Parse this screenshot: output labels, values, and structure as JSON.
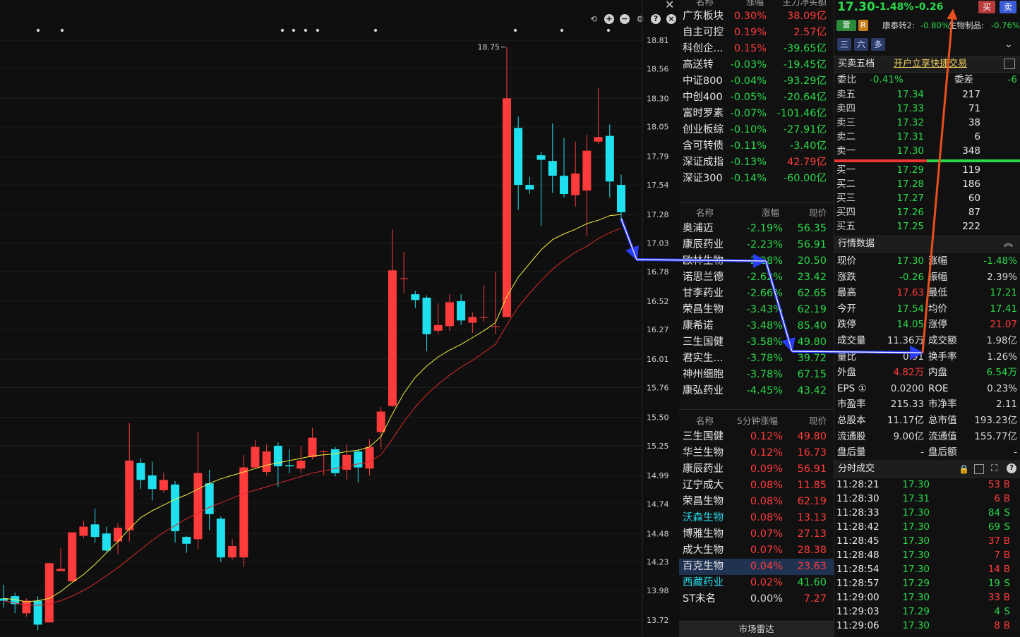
{
  "chart": {
    "price_ticks": [
      "18.81",
      "18.56",
      "18.30",
      "18.05",
      "17.79",
      "17.54",
      "17.28",
      "17.03",
      "16.78",
      "16.52",
      "16.27",
      "16.01",
      "15.76",
      "15.50",
      "15.25",
      "14.99",
      "14.74",
      "14.48",
      "14.23",
      "13.98",
      "13.72"
    ],
    "high_label": "18.75",
    "candles": [
      {
        "o": 13.91,
        "c": 13.89,
        "h": 14.03,
        "l": 13.83
      },
      {
        "o": 13.93,
        "c": 13.86,
        "h": 13.96,
        "l": 13.78
      },
      {
        "o": 13.78,
        "c": 13.89,
        "h": 13.91,
        "l": 13.75
      },
      {
        "o": 13.89,
        "c": 13.68,
        "h": 13.93,
        "l": 13.63
      },
      {
        "o": 13.7,
        "c": 14.22,
        "h": 14.22,
        "l": 13.7
      },
      {
        "o": 14.15,
        "c": 14.17,
        "h": 14.35,
        "l": 14.15
      },
      {
        "o": 14.06,
        "c": 14.49,
        "h": 14.49,
        "l": 14.06
      },
      {
        "o": 14.46,
        "c": 14.54,
        "h": 14.59,
        "l": 14.44
      },
      {
        "o": 14.56,
        "c": 14.45,
        "h": 14.7,
        "l": 14.4
      },
      {
        "o": 14.48,
        "c": 14.33,
        "h": 14.54,
        "l": 14.31
      },
      {
        "o": 14.41,
        "c": 14.53,
        "h": 14.57,
        "l": 14.3
      },
      {
        "o": 14.51,
        "c": 15.12,
        "h": 15.45,
        "l": 14.41
      },
      {
        "o": 15.1,
        "c": 14.95,
        "h": 15.14,
        "l": 14.87
      },
      {
        "o": 14.99,
        "c": 14.87,
        "h": 15.11,
        "l": 14.77
      },
      {
        "o": 14.86,
        "c": 14.95,
        "h": 15.01,
        "l": 14.84
      },
      {
        "o": 14.91,
        "c": 14.5,
        "h": 14.94,
        "l": 14.4
      },
      {
        "o": 14.45,
        "c": 14.39,
        "h": 14.46,
        "l": 14.31
      },
      {
        "o": 14.43,
        "c": 15.01,
        "h": 15.37,
        "l": 14.34
      },
      {
        "o": 14.92,
        "c": 14.65,
        "h": 15.04,
        "l": 14.51
      },
      {
        "o": 14.61,
        "c": 14.27,
        "h": 14.63,
        "l": 14.23
      },
      {
        "o": 14.27,
        "c": 14.37,
        "h": 14.43,
        "l": 14.25
      },
      {
        "o": 14.27,
        "c": 15.06,
        "h": 15.17,
        "l": 14.19
      },
      {
        "o": 15.06,
        "c": 15.24,
        "h": 15.3,
        "l": 15.05
      },
      {
        "o": 15.02,
        "c": 15.2,
        "h": 15.26,
        "l": 14.99
      },
      {
        "o": 15.25,
        "c": 15.07,
        "h": 15.28,
        "l": 14.89
      },
      {
        "o": 15.08,
        "c": 15.07,
        "h": 15.22,
        "l": 15.01
      },
      {
        "o": 15.05,
        "c": 15.12,
        "h": 15.25,
        "l": 15.01
      },
      {
        "o": 15.15,
        "c": 15.32,
        "h": 15.41,
        "l": 15.13
      },
      {
        "o": 15.2,
        "c": 15.2,
        "h": 15.21,
        "l": 14.99
      },
      {
        "o": 15.22,
        "c": 15.01,
        "h": 15.24,
        "l": 14.98
      },
      {
        "o": 15.04,
        "c": 15.17,
        "h": 15.26,
        "l": 14.95
      },
      {
        "o": 15.2,
        "c": 15.06,
        "h": 15.22,
        "l": 14.93
      },
      {
        "o": 15.05,
        "c": 15.24,
        "h": 15.31,
        "l": 14.99
      },
      {
        "o": 15.37,
        "c": 15.55,
        "h": 15.59,
        "l": 15.22
      },
      {
        "o": 15.6,
        "c": 16.79,
        "h": 17.15,
        "l": 15.59
      },
      {
        "o": 16.72,
        "c": 16.72,
        "h": 16.95,
        "l": 16.59
      },
      {
        "o": 16.58,
        "c": 16.53,
        "h": 16.61,
        "l": 16.46
      },
      {
        "o": 16.55,
        "c": 16.23,
        "h": 16.57,
        "l": 16.08
      },
      {
        "o": 16.26,
        "c": 16.31,
        "h": 16.5,
        "l": 16.23
      },
      {
        "o": 16.3,
        "c": 16.51,
        "h": 16.58,
        "l": 16.26
      },
      {
        "o": 16.52,
        "c": 16.35,
        "h": 16.58,
        "l": 16.31
      },
      {
        "o": 16.33,
        "c": 16.38,
        "h": 16.42,
        "l": 16.24
      },
      {
        "o": 16.38,
        "c": 16.38,
        "h": 16.66,
        "l": 16.34
      },
      {
        "o": 16.3,
        "c": 16.3,
        "h": 16.78,
        "l": 16.23
      },
      {
        "o": 16.38,
        "c": 18.3,
        "h": 18.75,
        "l": 16.38
      },
      {
        "o": 18.04,
        "c": 17.54,
        "h": 18.14,
        "l": 17.32
      },
      {
        "o": 17.54,
        "c": 17.5,
        "h": 17.61,
        "l": 17.46
      },
      {
        "o": 17.8,
        "c": 17.76,
        "h": 17.83,
        "l": 17.18
      },
      {
        "o": 17.75,
        "c": 17.62,
        "h": 18.08,
        "l": 17.47
      },
      {
        "o": 17.62,
        "c": 17.46,
        "h": 17.95,
        "l": 17.43
      },
      {
        "o": 17.45,
        "c": 17.64,
        "h": 17.92,
        "l": 17.35
      },
      {
        "o": 17.49,
        "c": 17.84,
        "h": 17.98,
        "l": 17.09
      },
      {
        "o": 17.92,
        "c": 17.96,
        "h": 18.39,
        "l": 17.9
      },
      {
        "o": 17.97,
        "c": 17.57,
        "h": 18.07,
        "l": 17.43
      },
      {
        "o": 17.54,
        "c": 17.3,
        "h": 17.63,
        "l": 17.21
      }
    ],
    "ma_yellow": [
      13.91,
      13.9,
      13.88,
      13.89,
      13.91,
      13.97,
      14.05,
      14.12,
      14.21,
      14.31,
      14.41,
      14.52,
      14.62,
      14.68,
      14.73,
      14.78,
      14.82,
      14.87,
      14.92,
      14.96,
      14.99,
      15.02,
      15.05,
      15.08,
      15.1,
      15.12,
      15.14,
      15.16,
      15.17,
      15.18,
      15.2,
      15.21,
      15.24,
      15.33,
      15.53,
      15.71,
      15.85,
      15.95,
      16.03,
      16.09,
      16.14,
      16.2,
      16.26,
      16.33,
      16.56,
      16.73,
      16.85,
      16.97,
      17.06,
      17.11,
      17.15,
      17.2,
      17.23,
      17.27,
      17.28
    ],
    "ma_red": [
      13.89,
      13.87,
      13.85,
      13.85,
      13.86,
      13.89,
      13.93,
      13.98,
      14.04,
      14.11,
      14.18,
      14.26,
      14.34,
      14.42,
      14.49,
      14.55,
      14.61,
      14.66,
      14.71,
      14.75,
      14.79,
      14.83,
      14.86,
      14.89,
      14.92,
      14.95,
      14.98,
      15.01,
      15.03,
      15.05,
      15.07,
      15.09,
      15.11,
      15.17,
      15.31,
      15.46,
      15.59,
      15.7,
      15.79,
      15.87,
      15.94,
      16.0,
      16.07,
      16.14,
      16.31,
      16.47,
      16.59,
      16.7,
      16.8,
      16.88,
      16.95,
      17.0,
      17.07,
      17.12,
      17.16
    ]
  },
  "sectors": {
    "headers": [
      "名称",
      "涨幅",
      "主力净买额"
    ],
    "rows": [
      {
        "name": "广东板块",
        "chg": "0.30%",
        "net": "38.09亿",
        "chg_dir": "up",
        "net_dir": "up"
      },
      {
        "name": "自主可控",
        "chg": "0.19%",
        "net": "2.57亿",
        "chg_dir": "up",
        "net_dir": "up"
      },
      {
        "name": "科创企...",
        "chg": "0.15%",
        "net": "-39.65亿",
        "chg_dir": "up",
        "net_dir": "down"
      },
      {
        "name": "高送转",
        "chg": "-0.03%",
        "net": "-19.45亿",
        "chg_dir": "down",
        "net_dir": "down"
      },
      {
        "name": "中证800",
        "chg": "-0.04%",
        "net": "-93.29亿",
        "chg_dir": "down",
        "net_dir": "down"
      },
      {
        "name": "中创400",
        "chg": "-0.05%",
        "net": "-20.64亿",
        "chg_dir": "down",
        "net_dir": "down"
      },
      {
        "name": "富时罗素",
        "chg": "-0.07%",
        "net": "-101.46亿",
        "chg_dir": "down",
        "net_dir": "down"
      },
      {
        "name": "创业板综",
        "chg": "-0.10%",
        "net": "-27.91亿",
        "chg_dir": "down",
        "net_dir": "down"
      },
      {
        "name": "含可转债",
        "chg": "-0.11%",
        "net": "-3.40亿",
        "chg_dir": "down",
        "net_dir": "down"
      },
      {
        "name": "深证成指",
        "chg": "-0.13%",
        "net": "42.79亿",
        "chg_dir": "down",
        "net_dir": "up"
      },
      {
        "name": "深证300",
        "chg": "-0.14%",
        "net": "-60.00亿",
        "chg_dir": "down",
        "net_dir": "down"
      }
    ]
  },
  "peers": {
    "headers": [
      "名称",
      "涨幅",
      "现价"
    ],
    "rows": [
      {
        "name": "奥浦迈",
        "chg": "-2.19%",
        "price": "56.35"
      },
      {
        "name": "康辰药业",
        "chg": "-2.23%",
        "price": "56.91"
      },
      {
        "name": "欧林生物",
        "chg": "-2.28%",
        "price": "20.50"
      },
      {
        "name": "诺思兰德",
        "chg": "-2.62%",
        "price": "23.42"
      },
      {
        "name": "甘李药业",
        "chg": "-2.66%",
        "price": "62.65"
      },
      {
        "name": "荣昌生物",
        "chg": "-3.43%",
        "price": "62.19"
      },
      {
        "name": "康希诺",
        "chg": "-3.48%",
        "price": "85.40"
      },
      {
        "name": "三生国健",
        "chg": "-3.58%",
        "price": "49.80"
      },
      {
        "name": "君实生...",
        "chg": "-3.78%",
        "price": "39.72"
      },
      {
        "name": "神州细胞",
        "chg": "-3.78%",
        "price": "67.15"
      },
      {
        "name": "康弘药业",
        "chg": "-4.45%",
        "price": "43.42"
      }
    ]
  },
  "fivemin": {
    "headers": [
      "名称",
      "5分钟涨幅",
      "现价"
    ],
    "rows": [
      {
        "name": "三生国健",
        "chg": "0.12%",
        "price": "49.80",
        "name_color": "normal",
        "dir": "up",
        "hl": false
      },
      {
        "name": "华兰生物",
        "chg": "0.12%",
        "price": "16.73",
        "name_color": "normal",
        "dir": "up",
        "hl": false
      },
      {
        "name": "康辰药业",
        "chg": "0.09%",
        "price": "56.91",
        "name_color": "normal",
        "dir": "up",
        "hl": false
      },
      {
        "name": "辽宁成大",
        "chg": "0.08%",
        "price": "11.85",
        "name_color": "normal",
        "dir": "up",
        "hl": false
      },
      {
        "name": "荣昌生物",
        "chg": "0.08%",
        "price": "62.19",
        "name_color": "normal",
        "dir": "up",
        "hl": false
      },
      {
        "name": "沃森生物",
        "chg": "0.08%",
        "price": "13.13",
        "name_color": "cyan",
        "dir": "up",
        "hl": false
      },
      {
        "name": "博雅生物",
        "chg": "0.07%",
        "price": "27.13",
        "name_color": "normal",
        "dir": "up",
        "hl": false
      },
      {
        "name": "成大生物",
        "chg": "0.07%",
        "price": "28.38",
        "name_color": "normal",
        "dir": "up",
        "hl": false
      },
      {
        "name": "百克生物",
        "chg": "0.04%",
        "price": "23.63",
        "name_color": "normal",
        "dir": "up",
        "hl": true
      },
      {
        "name": "西藏药业",
        "chg": "0.02%",
        "price": "41.60",
        "name_color": "cyan",
        "dir": "down",
        "hl": false
      },
      {
        "name": "ST未名",
        "chg": "0.00%",
        "price": "7.27",
        "name_color": "normal",
        "dir": "up",
        "hl": false
      }
    ],
    "radar_label": "市场雷达"
  },
  "quote": {
    "price": "17.30",
    "change_pct": "-1.48%",
    "change": "-0.26",
    "buy_label": "买",
    "sell_label": "卖",
    "badge_thunder": "雷",
    "badge_r": "R",
    "related1_label": "康泰转2:",
    "related1_value": "-0.80%",
    "related2_label": "生物制品:",
    "related2_value": "-0.76%",
    "view_tabs": [
      "三",
      "六",
      "多"
    ],
    "orderbook_title": "买卖五档",
    "promo_link": "开户立享快捷交易",
    "weibi_label": "委比",
    "weibi_value": "-0.41%",
    "weicha_label": "委差",
    "weicha_value": "-6",
    "asks": [
      {
        "label": "卖五",
        "price": "17.34",
        "vol": "217"
      },
      {
        "label": "卖四",
        "price": "17.33",
        "vol": "71"
      },
      {
        "label": "卖三",
        "price": "17.32",
        "vol": "38"
      },
      {
        "label": "卖二",
        "price": "17.31",
        "vol": "6"
      },
      {
        "label": "卖一",
        "price": "17.30",
        "vol": "348"
      }
    ],
    "bids": [
      {
        "label": "买一",
        "price": "17.29",
        "vol": "119"
      },
      {
        "label": "买二",
        "price": "17.28",
        "vol": "186"
      },
      {
        "label": "买三",
        "price": "17.27",
        "vol": "60"
      },
      {
        "label": "买四",
        "price": "17.26",
        "vol": "87"
      },
      {
        "label": "买五",
        "price": "17.25",
        "vol": "222"
      }
    ],
    "market_title": "行情数据",
    "stats": [
      {
        "l1": "现价",
        "v1": "17.30",
        "d1": "down",
        "l2": "涨幅",
        "v2": "-1.48%",
        "d2": "down"
      },
      {
        "l1": "涨跌",
        "v1": "-0.26",
        "d1": "down",
        "l2": "振幅",
        "v2": "2.39%",
        "d2": "flat"
      },
      {
        "l1": "最高",
        "v1": "17.63",
        "d1": "up",
        "l2": "最低",
        "v2": "17.21",
        "d2": "down"
      },
      {
        "l1": "今开",
        "v1": "17.54",
        "d1": "down",
        "l2": "均价",
        "v2": "17.41",
        "d2": "down"
      },
      {
        "l1": "跌停",
        "v1": "14.05",
        "d1": "down",
        "l2": "涨停",
        "v2": "21.07",
        "d2": "up"
      },
      {
        "l1": "成交量",
        "v1": "11.36万",
        "d1": "flat",
        "l2": "成交额",
        "v2": "1.98亿",
        "d2": "flat"
      },
      {
        "l1": "量比",
        "v1": "0.91",
        "d1": "flat",
        "l2": "换手率",
        "v2": "1.26%",
        "d2": "flat"
      },
      {
        "l1": "外盘",
        "v1": "4.82万",
        "d1": "up",
        "l2": "内盘",
        "v2": "6.54万",
        "d2": "down"
      },
      {
        "l1": "EPS ①",
        "v1": "0.0200",
        "d1": "flat",
        "l2": "ROE",
        "v2": "0.23%",
        "d2": "flat"
      },
      {
        "l1": "市盈率",
        "v1": "215.33",
        "d1": "flat",
        "l2": "市净率",
        "v2": "2.11",
        "d2": "flat"
      },
      {
        "l1": "总股本",
        "v1": "11.17亿",
        "d1": "flat",
        "l2": "总市值",
        "v2": "193.23亿",
        "d2": "flat"
      },
      {
        "l1": "流通股",
        "v1": "9.00亿",
        "d1": "flat",
        "l2": "流通值",
        "v2": "155.77亿",
        "d2": "flat"
      },
      {
        "l1": "盘后量",
        "v1": "-",
        "d1": "flat",
        "l2": "盘后额",
        "v2": "-",
        "d2": "flat"
      }
    ],
    "ticks_title": "分时成交",
    "ticks": [
      {
        "time": "11:28:21",
        "price": "17.30",
        "vol": "53",
        "side": "B"
      },
      {
        "time": "11:28:30",
        "price": "17.31",
        "vol": "6",
        "side": "B"
      },
      {
        "time": "11:28:33",
        "price": "17.30",
        "vol": "84",
        "side": "S"
      },
      {
        "time": "11:28:42",
        "price": "17.30",
        "vol": "69",
        "side": "S"
      },
      {
        "time": "11:28:45",
        "price": "17.30",
        "vol": "37",
        "side": "B"
      },
      {
        "time": "11:28:48",
        "price": "17.30",
        "vol": "7",
        "side": "B"
      },
      {
        "time": "11:28:54",
        "price": "17.30",
        "vol": "14",
        "side": "B"
      },
      {
        "time": "11:28:57",
        "price": "17.29",
        "vol": "19",
        "side": "S"
      },
      {
        "time": "11:29:00",
        "price": "17.30",
        "vol": "33",
        "side": "B"
      },
      {
        "time": "11:29:03",
        "price": "17.29",
        "vol": "4",
        "side": "S"
      },
      {
        "time": "11:29:06",
        "price": "17.30",
        "vol": "8",
        "side": "B"
      }
    ]
  },
  "colors": {
    "up": "#ff3b3b",
    "down": "#2ad84a",
    "candle_down": "#1fe0ee",
    "ma_yellow": "#f2ef3c",
    "ma_red": "#d92a2a",
    "arrow_blue": "#2a3cff",
    "arrow_orange": "#e8501e"
  }
}
